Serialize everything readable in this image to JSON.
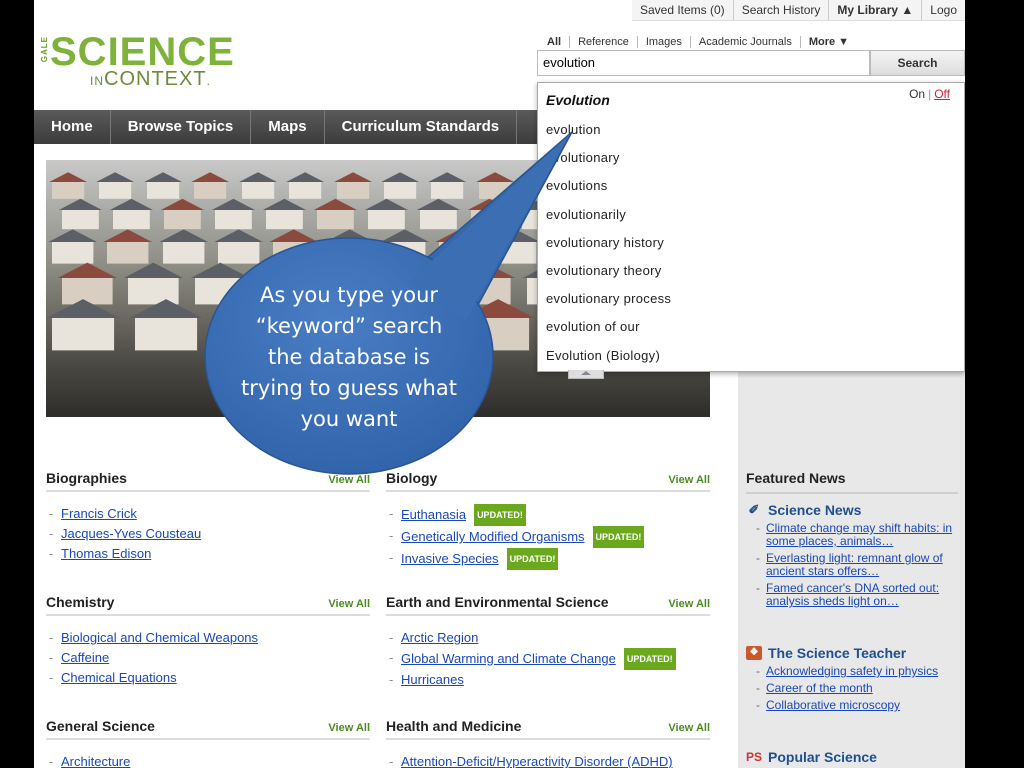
{
  "util_bar": {
    "saved_items": "Saved Items (0)",
    "search_history": "Search History",
    "my_library": "My Library ▲",
    "logout": "Logo"
  },
  "logo": {
    "gale": "GALE",
    "science": "SCIENCE",
    "in": "IN",
    "context": "CONTEXT",
    "tm": "."
  },
  "search": {
    "tabs": [
      "All",
      "Reference",
      "Images",
      "Academic Journals",
      "More ▼"
    ],
    "value": "evolution",
    "button": "Search"
  },
  "nav": [
    "Home",
    "Browse Topics",
    "Maps",
    "Curriculum Standards"
  ],
  "autocomplete": {
    "on": "On",
    "sep": "|",
    "off": "Off",
    "first": "Evolution",
    "suggestions": [
      "evolution",
      "evolutionary",
      "evolutions",
      "evolutionarily",
      "evolutionary history",
      "evolutionary theory",
      "evolutionary process",
      "evolution of our",
      "Evolution (Biology)"
    ]
  },
  "callout": {
    "text": "As you type your “keyword” search the database is trying to guess what you want"
  },
  "topics": {
    "view_all": "View All",
    "updated": "UPDATED!",
    "biographies": {
      "title": "Biographies",
      "items": [
        "Francis Crick",
        "Jacques-Yves Cousteau",
        "Thomas Edison"
      ]
    },
    "biology": {
      "title": "Biology",
      "items": [
        "Euthanasia",
        "Genetically Modified Organisms",
        "Invasive Species"
      ]
    },
    "chemistry": {
      "title": "Chemistry",
      "items": [
        "Biological and Chemical Weapons",
        "Caffeine",
        "Chemical Equations"
      ]
    },
    "earth": {
      "title": "Earth and Environmental Science",
      "items": [
        "Arctic Region",
        "Global Warming and Climate Change",
        "Hurricanes"
      ]
    },
    "general": {
      "title": "General Science",
      "items": [
        "Architecture"
      ]
    },
    "health": {
      "title": "Health and Medicine",
      "items": [
        "Attention-Deficit/Hyperactivity Disorder (ADHD)"
      ]
    }
  },
  "featured_news": {
    "title": "Featured News",
    "science_news": {
      "title": "Science News",
      "items": [
        "Climate change may shift habits: in some places, animals…",
        "Everlasting light: remnant glow of ancient stars offers…",
        "Famed cancer's DNA sorted out: analysis sheds light on…"
      ]
    },
    "science_teacher": {
      "title": "The Science Teacher",
      "items": [
        "Acknowledging safety in physics",
        "Career of the month",
        "Collaborative microscopy"
      ]
    },
    "popular_science": {
      "title": "Popular Science",
      "icon_text": "PS"
    }
  }
}
